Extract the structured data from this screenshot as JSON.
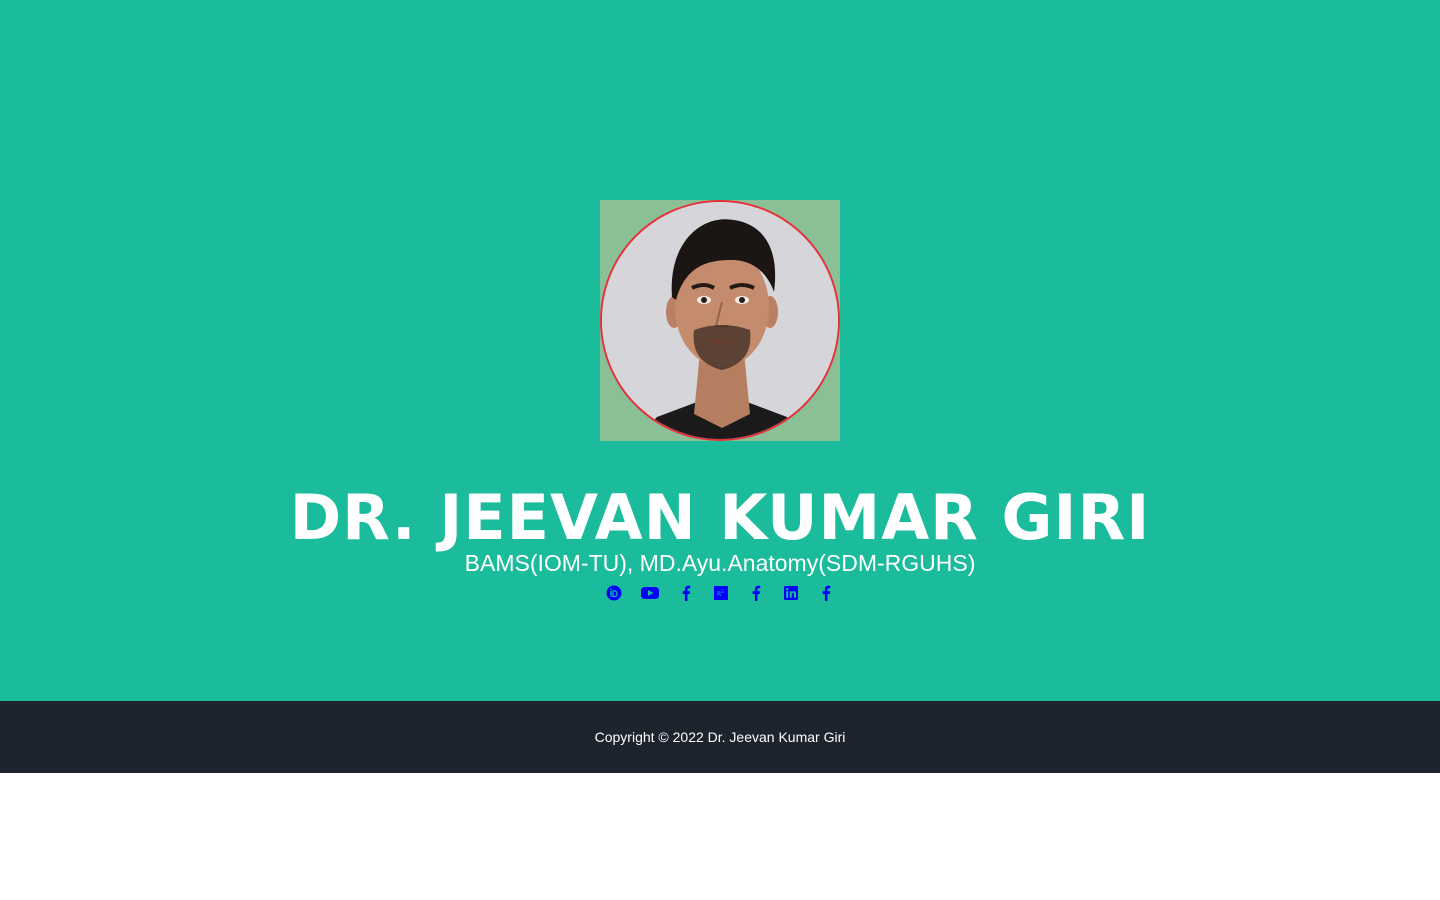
{
  "profile": {
    "name": "DR. JEEVAN KUMAR GIRI",
    "credentials": "BAMS(IOM-TU), MD.Ayu.Anatomy(SDM-RGUHS)"
  },
  "social_links": [
    {
      "icon": "orcid-icon"
    },
    {
      "icon": "youtube-icon"
    },
    {
      "icon": "facebook-icon"
    },
    {
      "icon": "researchgate-icon"
    },
    {
      "icon": "facebook-icon"
    },
    {
      "icon": "linkedin-icon"
    },
    {
      "icon": "facebook-icon"
    }
  ],
  "footer": {
    "copyright": "Copyright © 2022 Dr. Jeevan Kumar Giri"
  },
  "colors": {
    "hero_bg": "#1abc9c",
    "footer_bg": "#1e242e",
    "icon_color": "#0000ff",
    "avatar_border": "#e4323a"
  }
}
